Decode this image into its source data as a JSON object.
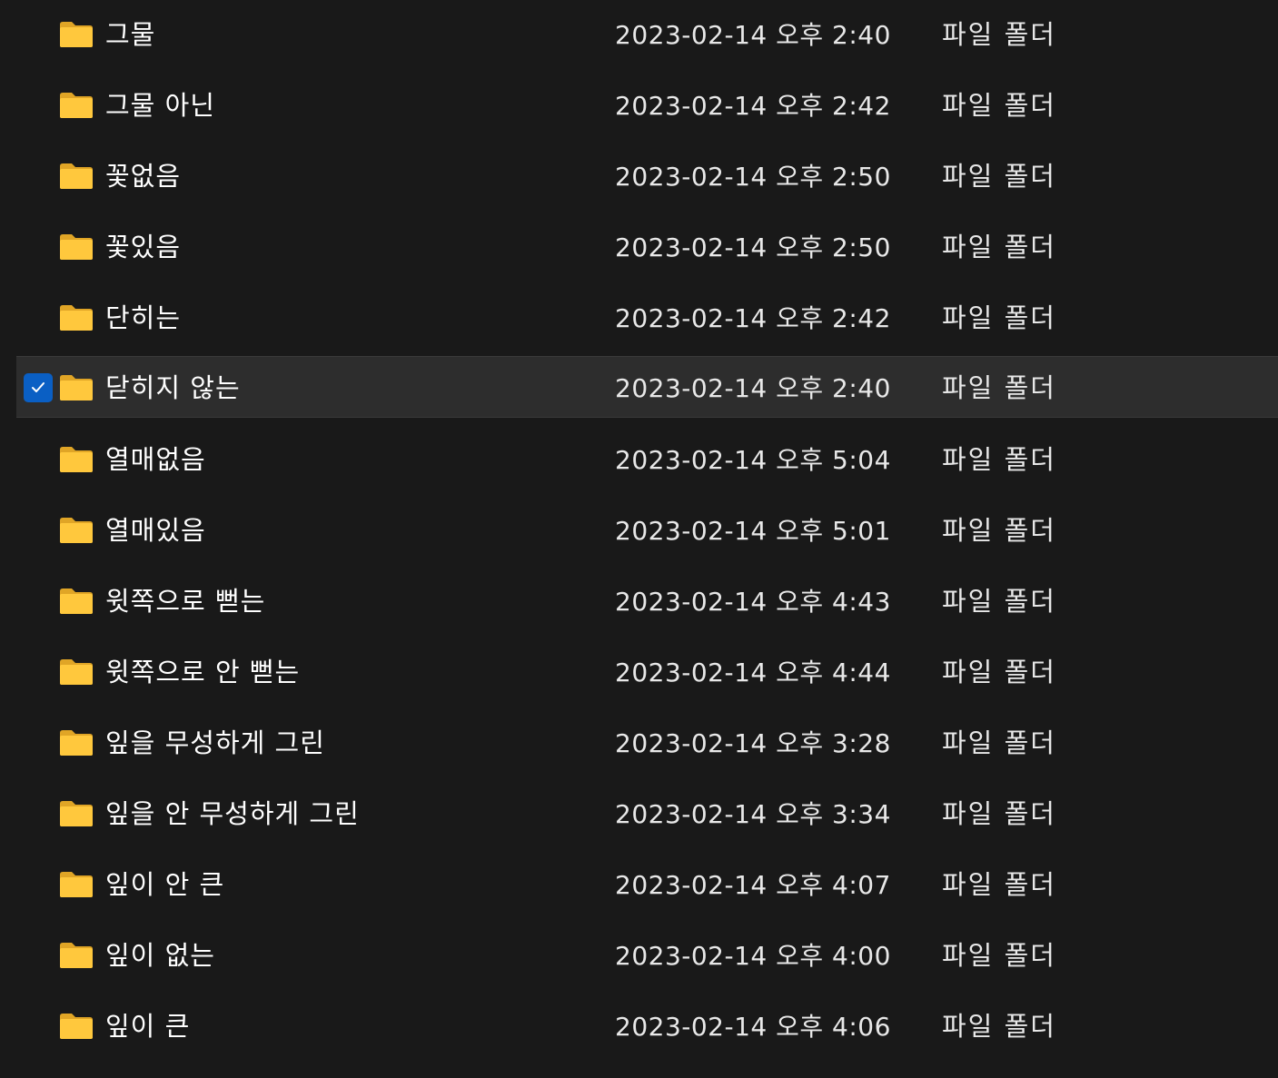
{
  "colors": {
    "background": "#191919",
    "selected_row": "#2d2d2d",
    "checkbox": "#0a5fc4",
    "folder": "#ffc83d"
  },
  "files": [
    {
      "name": "그물",
      "modified": "2023-02-14 오후 2:40",
      "type": "파일 폴더",
      "icon": "folder-icon",
      "selected": false
    },
    {
      "name": "그물 아닌",
      "modified": "2023-02-14 오후 2:42",
      "type": "파일 폴더",
      "icon": "folder-icon",
      "selected": false
    },
    {
      "name": "꽃없음",
      "modified": "2023-02-14 오후 2:50",
      "type": "파일 폴더",
      "icon": "folder-icon",
      "selected": false
    },
    {
      "name": "꽃있음",
      "modified": "2023-02-14 오후 2:50",
      "type": "파일 폴더",
      "icon": "folder-icon",
      "selected": false
    },
    {
      "name": "단히는",
      "modified": "2023-02-14 오후 2:42",
      "type": "파일 폴더",
      "icon": "folder-icon",
      "selected": false
    },
    {
      "name": "닫히지 않는",
      "modified": "2023-02-14 오후 2:40",
      "type": "파일 폴더",
      "icon": "folder-icon",
      "selected": true
    },
    {
      "name": "열매없음",
      "modified": "2023-02-14 오후 5:04",
      "type": "파일 폴더",
      "icon": "folder-icon",
      "selected": false
    },
    {
      "name": "열매있음",
      "modified": "2023-02-14 오후 5:01",
      "type": "파일 폴더",
      "icon": "folder-icon",
      "selected": false
    },
    {
      "name": "윗쪽으로 뻗는",
      "modified": "2023-02-14 오후 4:43",
      "type": "파일 폴더",
      "icon": "folder-icon",
      "selected": false
    },
    {
      "name": "윗쪽으로 안 뻗는",
      "modified": "2023-02-14 오후 4:44",
      "type": "파일 폴더",
      "icon": "folder-icon",
      "selected": false
    },
    {
      "name": "잎을 무성하게 그린",
      "modified": "2023-02-14 오후 3:28",
      "type": "파일 폴더",
      "icon": "folder-icon",
      "selected": false
    },
    {
      "name": "잎을 안 무성하게 그린",
      "modified": "2023-02-14 오후 3:34",
      "type": "파일 폴더",
      "icon": "folder-icon",
      "selected": false
    },
    {
      "name": "잎이 안 큰",
      "modified": "2023-02-14 오후 4:07",
      "type": "파일 폴더",
      "icon": "folder-icon",
      "selected": false
    },
    {
      "name": "잎이 없는",
      "modified": "2023-02-14 오후 4:00",
      "type": "파일 폴더",
      "icon": "folder-icon",
      "selected": false
    },
    {
      "name": "잎이 큰",
      "modified": "2023-02-14 오후 4:06",
      "type": "파일 폴더",
      "icon": "folder-icon",
      "selected": false
    }
  ]
}
